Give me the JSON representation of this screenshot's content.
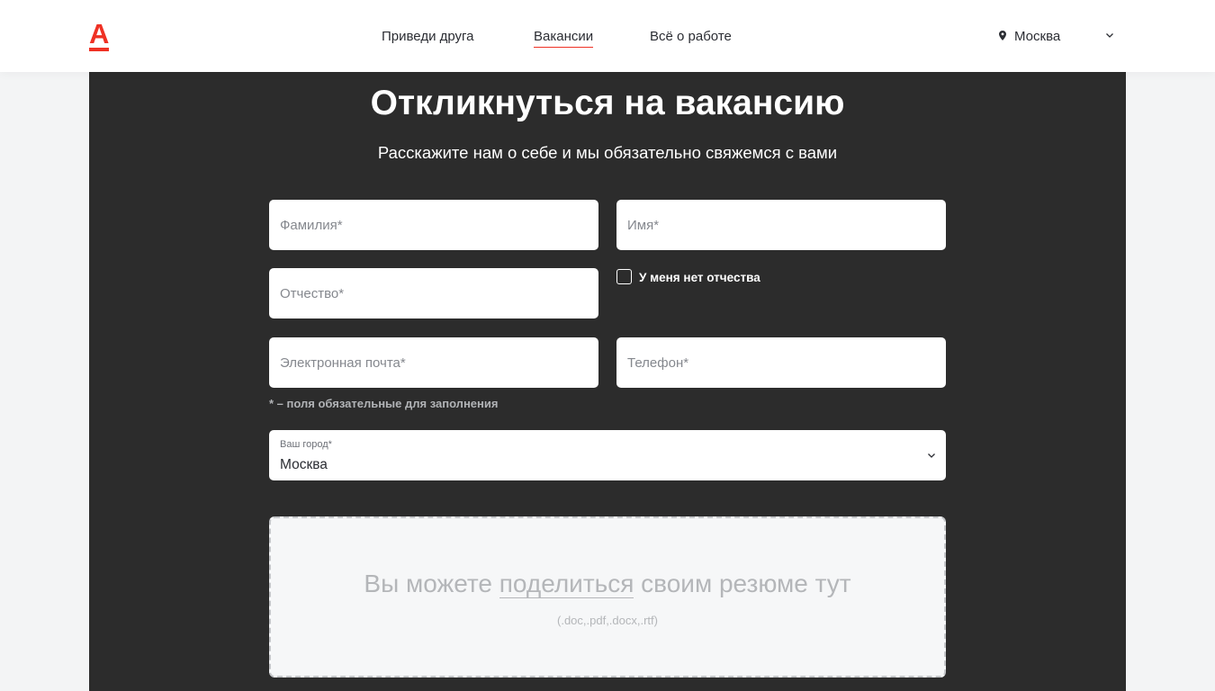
{
  "colors": {
    "brand": "#ef3124",
    "panel_background": "#2c2c2c",
    "page_background": "#f3f4f5"
  },
  "header": {
    "logo_letter": "А",
    "nav": [
      {
        "label": "Приведи друга",
        "active": false
      },
      {
        "label": "Вакансии",
        "active": true
      },
      {
        "label": "Всё о работе",
        "active": false
      }
    ],
    "location": {
      "icon": "location-pin-icon",
      "city": "Москва",
      "dropdown_icon": "chevron-down-icon"
    }
  },
  "form": {
    "title": "Откликнуться на вакансию",
    "subtitle": "Расскажите нам о себе и мы обязательно свяжемся с вами",
    "fields": {
      "surname": {
        "placeholder": "Фамилия*",
        "value": ""
      },
      "name": {
        "placeholder": "Имя*",
        "value": ""
      },
      "patronymic": {
        "placeholder": "Отчество*",
        "value": ""
      },
      "email": {
        "placeholder": "Электронная почта*",
        "value": ""
      },
      "phone": {
        "placeholder": "Телефон*",
        "value": ""
      }
    },
    "no_patronymic_checkbox": {
      "label": "У меня нет отчества",
      "checked": false
    },
    "required_note": "* – поля обязательные для заполнения",
    "city": {
      "label": "Ваш город",
      "required_mark": "*",
      "value": "Москва"
    },
    "resume": {
      "text_before": "Вы можете ",
      "link": "поделиться",
      "text_after": " своим резюме тут",
      "formats": "(.doc,.pdf,.docx,.rtf)"
    }
  }
}
